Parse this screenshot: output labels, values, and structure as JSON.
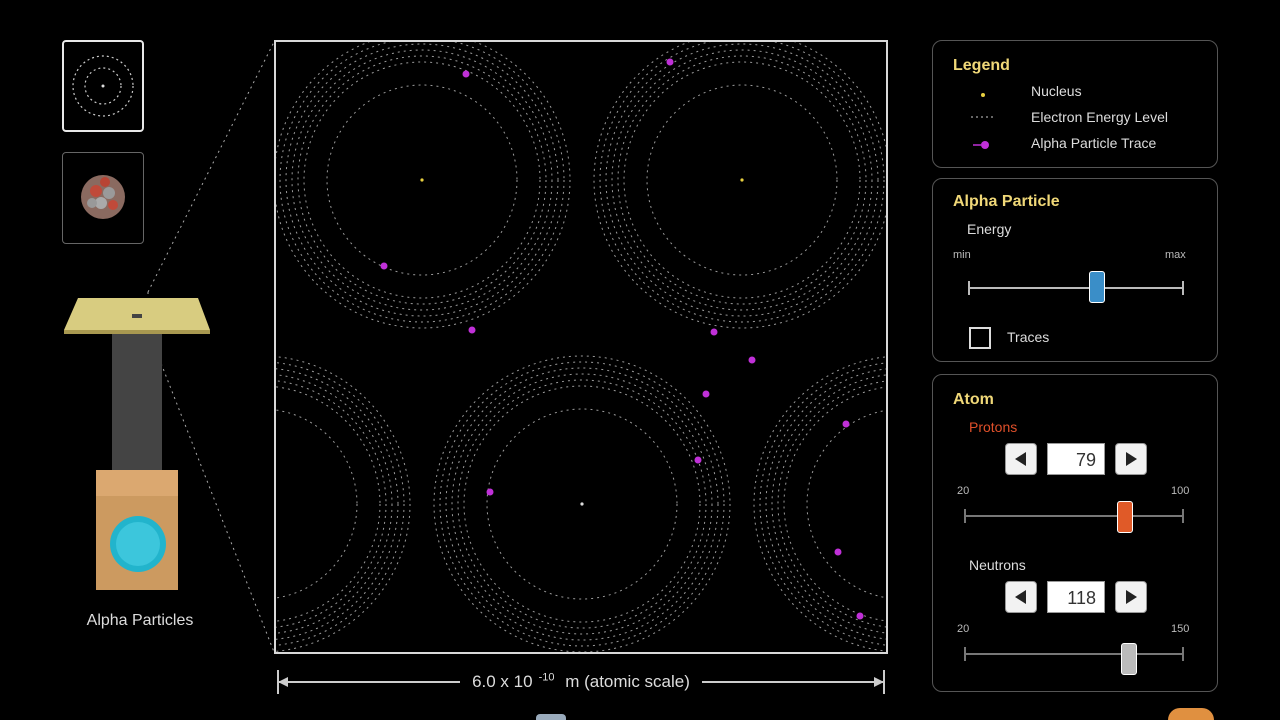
{
  "gun": {
    "label": "Alpha Particles"
  },
  "scale_bar": {
    "label_prefix": "6.0 x 10",
    "label_exponent": "-10",
    "label_suffix": " m (atomic scale)"
  },
  "legend": {
    "title": "Legend",
    "items": [
      {
        "icon": "nucleus-dot-icon",
        "label": "Nucleus"
      },
      {
        "icon": "energy-level-icon",
        "label": "Electron Energy Level"
      },
      {
        "icon": "alpha-particle-trace-icon",
        "label": "Alpha Particle Trace"
      }
    ]
  },
  "alpha_particle": {
    "title": "Alpha Particle",
    "energy_label": "Energy",
    "min_label": "min",
    "max_label": "max",
    "energy_fraction": 0.6,
    "traces_label": "Traces",
    "traces_checked": false
  },
  "atom": {
    "title": "Atom",
    "protons": {
      "label": "Protons",
      "value": "79",
      "min": "20",
      "max": "100"
    },
    "neutrons": {
      "label": "Neutrons",
      "value": "118",
      "min": "20",
      "max": "150"
    }
  },
  "colors": {
    "panel_title": "#f0d878",
    "protons_label": "#e0502a",
    "alpha_trace": "#c030d8",
    "nucleus": "#e8d040",
    "energy_thumb": "#3a8ec8",
    "protons_thumb": "#e05a28",
    "neutrons_thumb": "#bbbbbb",
    "gun_muzzle": "#22b4cc"
  }
}
